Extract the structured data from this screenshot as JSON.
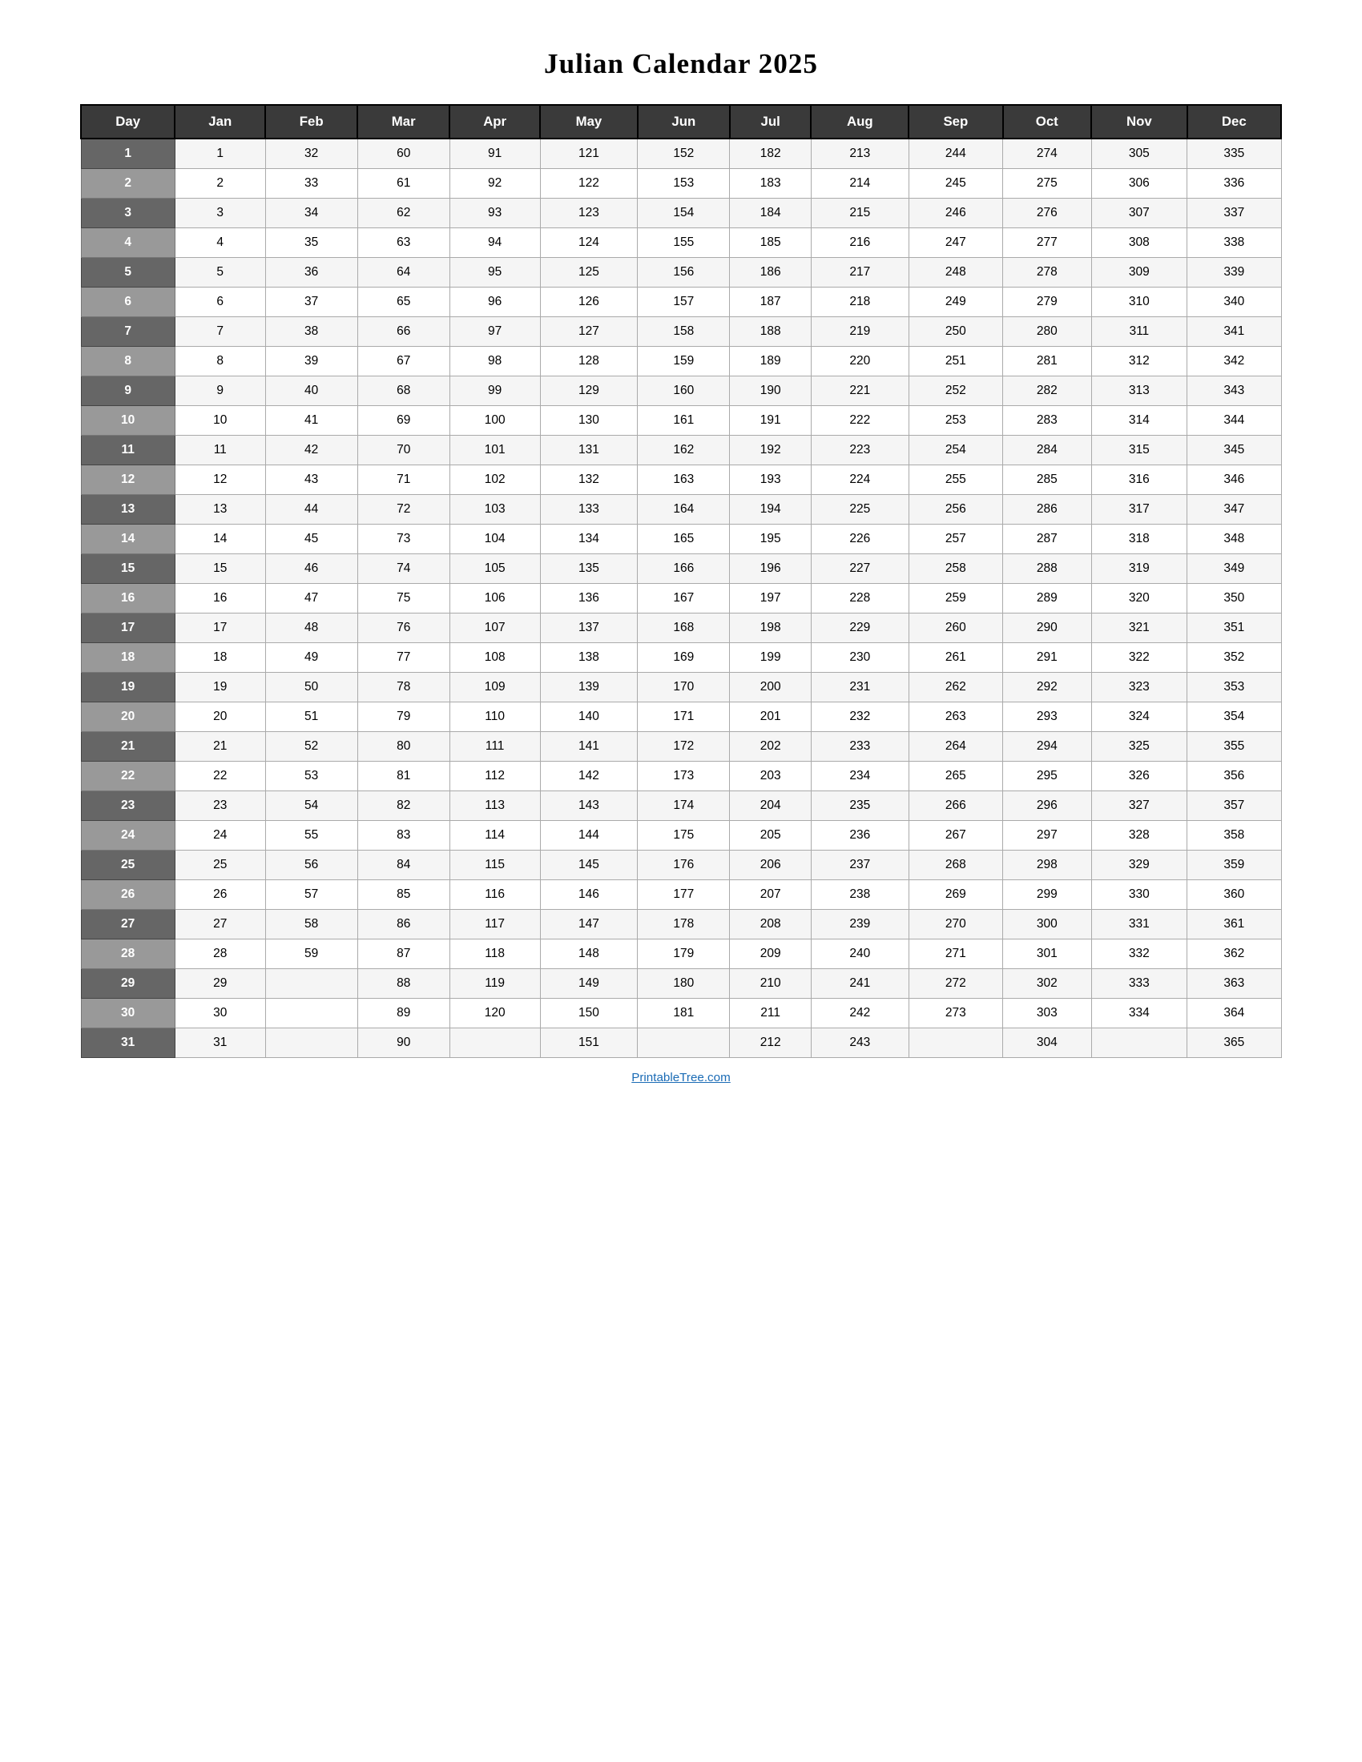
{
  "title": "Julian Calendar 2025",
  "footer_link": "PrintableTree.com",
  "columns": [
    "Day",
    "Jan",
    "Feb",
    "Mar",
    "Apr",
    "May",
    "Jun",
    "Jul",
    "Aug",
    "Sep",
    "Oct",
    "Nov",
    "Dec"
  ],
  "rows": [
    [
      1,
      1,
      32,
      60,
      91,
      121,
      152,
      182,
      213,
      244,
      274,
      305,
      335
    ],
    [
      2,
      2,
      33,
      61,
      92,
      122,
      153,
      183,
      214,
      245,
      275,
      306,
      336
    ],
    [
      3,
      3,
      34,
      62,
      93,
      123,
      154,
      184,
      215,
      246,
      276,
      307,
      337
    ],
    [
      4,
      4,
      35,
      63,
      94,
      124,
      155,
      185,
      216,
      247,
      277,
      308,
      338
    ],
    [
      5,
      5,
      36,
      64,
      95,
      125,
      156,
      186,
      217,
      248,
      278,
      309,
      339
    ],
    [
      6,
      6,
      37,
      65,
      96,
      126,
      157,
      187,
      218,
      249,
      279,
      310,
      340
    ],
    [
      7,
      7,
      38,
      66,
      97,
      127,
      158,
      188,
      219,
      250,
      280,
      311,
      341
    ],
    [
      8,
      8,
      39,
      67,
      98,
      128,
      159,
      189,
      220,
      251,
      281,
      312,
      342
    ],
    [
      9,
      9,
      40,
      68,
      99,
      129,
      160,
      190,
      221,
      252,
      282,
      313,
      343
    ],
    [
      10,
      10,
      41,
      69,
      100,
      130,
      161,
      191,
      222,
      253,
      283,
      314,
      344
    ],
    [
      11,
      11,
      42,
      70,
      101,
      131,
      162,
      192,
      223,
      254,
      284,
      315,
      345
    ],
    [
      12,
      12,
      43,
      71,
      102,
      132,
      163,
      193,
      224,
      255,
      285,
      316,
      346
    ],
    [
      13,
      13,
      44,
      72,
      103,
      133,
      164,
      194,
      225,
      256,
      286,
      317,
      347
    ],
    [
      14,
      14,
      45,
      73,
      104,
      134,
      165,
      195,
      226,
      257,
      287,
      318,
      348
    ],
    [
      15,
      15,
      46,
      74,
      105,
      135,
      166,
      196,
      227,
      258,
      288,
      319,
      349
    ],
    [
      16,
      16,
      47,
      75,
      106,
      136,
      167,
      197,
      228,
      259,
      289,
      320,
      350
    ],
    [
      17,
      17,
      48,
      76,
      107,
      137,
      168,
      198,
      229,
      260,
      290,
      321,
      351
    ],
    [
      18,
      18,
      49,
      77,
      108,
      138,
      169,
      199,
      230,
      261,
      291,
      322,
      352
    ],
    [
      19,
      19,
      50,
      78,
      109,
      139,
      170,
      200,
      231,
      262,
      292,
      323,
      353
    ],
    [
      20,
      20,
      51,
      79,
      110,
      140,
      171,
      201,
      232,
      263,
      293,
      324,
      354
    ],
    [
      21,
      21,
      52,
      80,
      111,
      141,
      172,
      202,
      233,
      264,
      294,
      325,
      355
    ],
    [
      22,
      22,
      53,
      81,
      112,
      142,
      173,
      203,
      234,
      265,
      295,
      326,
      356
    ],
    [
      23,
      23,
      54,
      82,
      113,
      143,
      174,
      204,
      235,
      266,
      296,
      327,
      357
    ],
    [
      24,
      24,
      55,
      83,
      114,
      144,
      175,
      205,
      236,
      267,
      297,
      328,
      358
    ],
    [
      25,
      25,
      56,
      84,
      115,
      145,
      176,
      206,
      237,
      268,
      298,
      329,
      359
    ],
    [
      26,
      26,
      57,
      85,
      116,
      146,
      177,
      207,
      238,
      269,
      299,
      330,
      360
    ],
    [
      27,
      27,
      58,
      86,
      117,
      147,
      178,
      208,
      239,
      270,
      300,
      331,
      361
    ],
    [
      28,
      28,
      59,
      87,
      118,
      148,
      179,
      209,
      240,
      271,
      301,
      332,
      362
    ],
    [
      29,
      29,
      "",
      88,
      119,
      149,
      180,
      210,
      241,
      272,
      302,
      333,
      363
    ],
    [
      30,
      30,
      "",
      89,
      120,
      150,
      181,
      211,
      242,
      273,
      303,
      334,
      364
    ],
    [
      31,
      31,
      "",
      90,
      "",
      151,
      "",
      212,
      243,
      "",
      304,
      "",
      365
    ]
  ]
}
